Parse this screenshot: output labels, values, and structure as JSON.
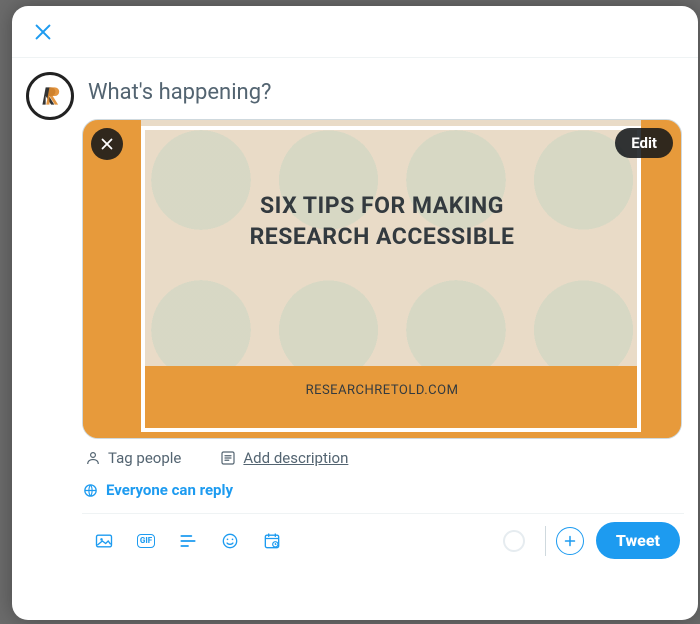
{
  "modal": {
    "close_aria": "Close"
  },
  "compose": {
    "placeholder": "What's happening?"
  },
  "media": {
    "edit_label": "Edit",
    "remove_aria": "Remove media",
    "image_title_line1": "SIX TIPS FOR MAKING",
    "image_title_line2": "RESEARCH ACCESSIBLE",
    "image_footer": "RESEARCHRETOLD.COM",
    "tag_people_label": "Tag people",
    "add_description_label": "Add description"
  },
  "reply_setting": {
    "label": "Everyone can reply"
  },
  "toolbar": {
    "gif_label": "GIF",
    "tweet_label": "Tweet"
  }
}
